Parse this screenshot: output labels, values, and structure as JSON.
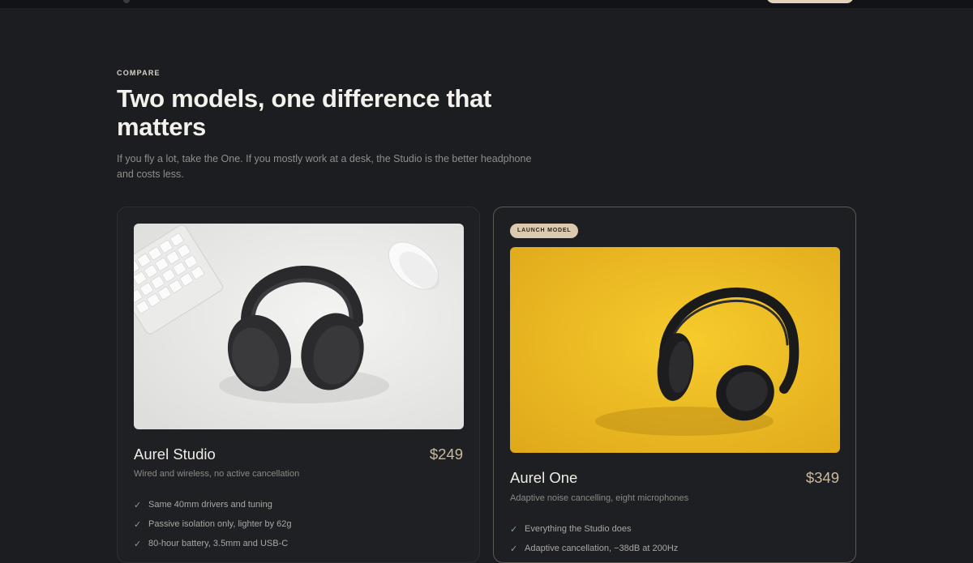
{
  "header": {
    "eyebrow": "COMPARE",
    "title": "Two models, one difference that matters",
    "subtitle": "If you fly a lot, take the One. If you mostly work at a desk, the Studio is the better headphone and costs less."
  },
  "cards": [
    {
      "name": "Aurel Studio",
      "price": "$249",
      "tagline": "Wired and wireless, no active cancellation",
      "features": [
        "Same 40mm drivers and tuning",
        "Passive isolation only, lighter by 62g",
        "80-hour battery, 3.5mm and USB-C"
      ],
      "icon": "check-icon"
    },
    {
      "badge": "LAUNCH MODEL",
      "name": "Aurel One",
      "price": "$349",
      "tagline": "Adaptive noise cancelling, eight microphones",
      "features": [
        "Everything the Studio does",
        "Adaptive cancellation, −38dB at 200Hz"
      ],
      "icon": "check-icon"
    }
  ],
  "colors": {
    "background": "#1c1d20",
    "accent": "#cbb99d",
    "badge": "#dccab0",
    "check": "#7fa38e"
  }
}
